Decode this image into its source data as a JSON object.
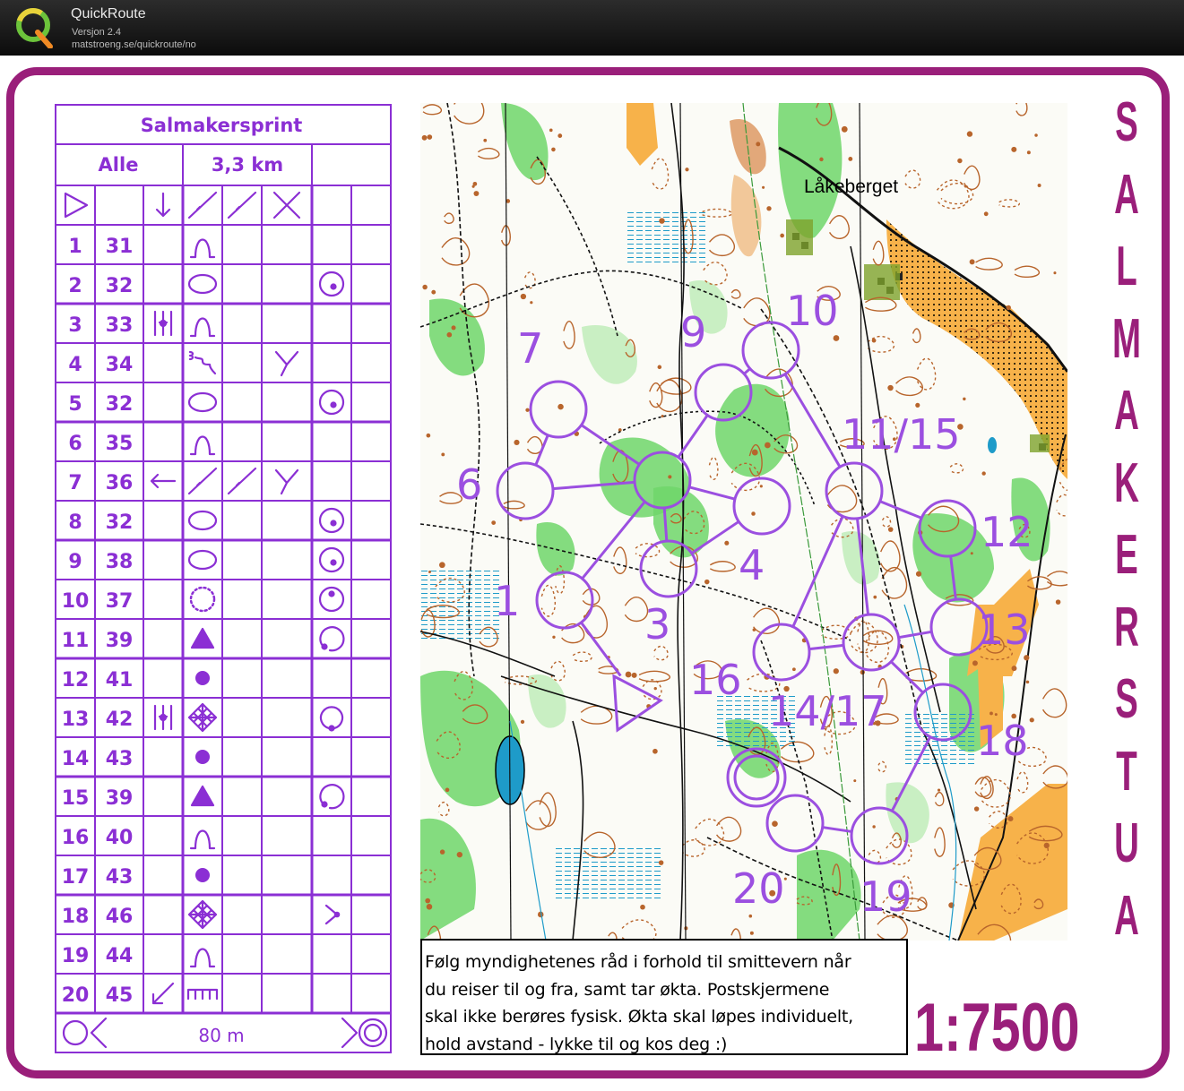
{
  "app": {
    "title": "QuickRoute",
    "version": "Versjon 2.4",
    "url": "matstroeng.se/quickroute/no"
  },
  "colors": {
    "frame": "#9a1f7a",
    "course": "#9b4fe0",
    "description_sheet": "#8b2fd4",
    "forest_green": "#6fd66a",
    "open_yellow": "#f7b24a",
    "water": "#1e9bc9",
    "contour_brown": "#b8652c"
  },
  "description_sheet": {
    "event": "Salmakersprint",
    "class": "Alle",
    "length": "3,3 km",
    "start_row_icons": [
      "start-triangle-icon",
      "",
      "arrow-down-icon",
      "forward-slash-icon",
      "forward-slash-icon",
      "cross-icon",
      "",
      ""
    ],
    "controls": [
      {
        "num": "1",
        "code": "31",
        "c": "",
        "d": "knoll-icon",
        "e": "",
        "f": "",
        "g": "",
        "h": ""
      },
      {
        "num": "2",
        "code": "32",
        "c": "",
        "d": "depression-icon",
        "e": "",
        "f": "",
        "g": "position-bottom-icon",
        "h": ""
      },
      {
        "num": "3",
        "code": "33",
        "c": "between-icon",
        "d": "knoll-icon",
        "e": "",
        "f": "",
        "g": "",
        "h": ""
      },
      {
        "num": "4",
        "code": "34",
        "c": "",
        "d": "erosion-gully-icon",
        "e": "",
        "f": "junction-icon",
        "g": "",
        "h": ""
      },
      {
        "num": "5",
        "code": "32",
        "c": "",
        "d": "depression-icon",
        "e": "",
        "f": "",
        "g": "position-bottom-icon",
        "h": ""
      },
      {
        "num": "6",
        "code": "35",
        "c": "",
        "d": "knoll-icon",
        "e": "",
        "f": "",
        "g": "",
        "h": ""
      },
      {
        "num": "7",
        "code": "36",
        "c": "arrow-left-icon",
        "d": "forward-slash-icon",
        "e": "forward-slash-icon",
        "f": "junction-icon",
        "g": "",
        "h": ""
      },
      {
        "num": "8",
        "code": "32",
        "c": "",
        "d": "depression-icon",
        "e": "",
        "f": "",
        "g": "position-bottom-icon",
        "h": ""
      },
      {
        "num": "9",
        "code": "38",
        "c": "",
        "d": "depression-icon",
        "e": "",
        "f": "",
        "g": "position-bottom-icon",
        "h": ""
      },
      {
        "num": "10",
        "code": "37",
        "c": "",
        "d": "dotted-circle-icon",
        "e": "",
        "f": "",
        "g": "position-top-icon",
        "h": ""
      },
      {
        "num": "11",
        "code": "39",
        "c": "",
        "d": "triangle-icon",
        "e": "",
        "f": "",
        "g": "position-sw-icon",
        "h": ""
      },
      {
        "num": "12",
        "code": "41",
        "c": "",
        "d": "dot-icon",
        "e": "",
        "f": "",
        "g": "",
        "h": ""
      },
      {
        "num": "13",
        "code": "42",
        "c": "between-icon",
        "d": "thicket-icon",
        "e": "",
        "f": "",
        "g": "position-bottom-open-icon",
        "h": ""
      },
      {
        "num": "14",
        "code": "43",
        "c": "",
        "d": "dot-icon",
        "e": "",
        "f": "",
        "g": "",
        "h": ""
      },
      {
        "num": "15",
        "code": "39",
        "c": "",
        "d": "triangle-icon",
        "e": "",
        "f": "",
        "g": "position-sw-icon",
        "h": ""
      },
      {
        "num": "16",
        "code": "40",
        "c": "",
        "d": "knoll-icon",
        "e": "",
        "f": "",
        "g": "",
        "h": ""
      },
      {
        "num": "17",
        "code": "43",
        "c": "",
        "d": "dot-icon",
        "e": "",
        "f": "",
        "g": "",
        "h": ""
      },
      {
        "num": "18",
        "code": "46",
        "c": "",
        "d": "thicket-icon",
        "e": "",
        "f": "",
        "g": "chevron-right-icon",
        "h": ""
      },
      {
        "num": "19",
        "code": "44",
        "c": "",
        "d": "knoll-icon",
        "e": "",
        "f": "",
        "g": "",
        "h": ""
      },
      {
        "num": "20",
        "code": "45",
        "c": "arrow-down-left-icon",
        "d": "fence-icon",
        "e": "",
        "f": "",
        "g": "",
        "h": ""
      }
    ],
    "finish_distance": "80 m"
  },
  "map": {
    "place_name": "Låkeberget",
    "control_labels": [
      "1",
      "3",
      "4",
      "6",
      "7",
      "9",
      "10",
      "11/15",
      "12",
      "13",
      "14/17",
      "16",
      "18",
      "19",
      "20"
    ]
  },
  "notice": {
    "lines": [
      "Følg myndighetenes råd i forhold til smittevern når",
      "du reiser til og fra, samt tar økta. Postskjermene",
      "skal ikke berøres fysisk. Økta skal løpes individuelt,",
      "hold avstand - lykke til og kos deg :)"
    ]
  },
  "vertical_title": "SALMAKERSTUA",
  "scale": "1:7500"
}
